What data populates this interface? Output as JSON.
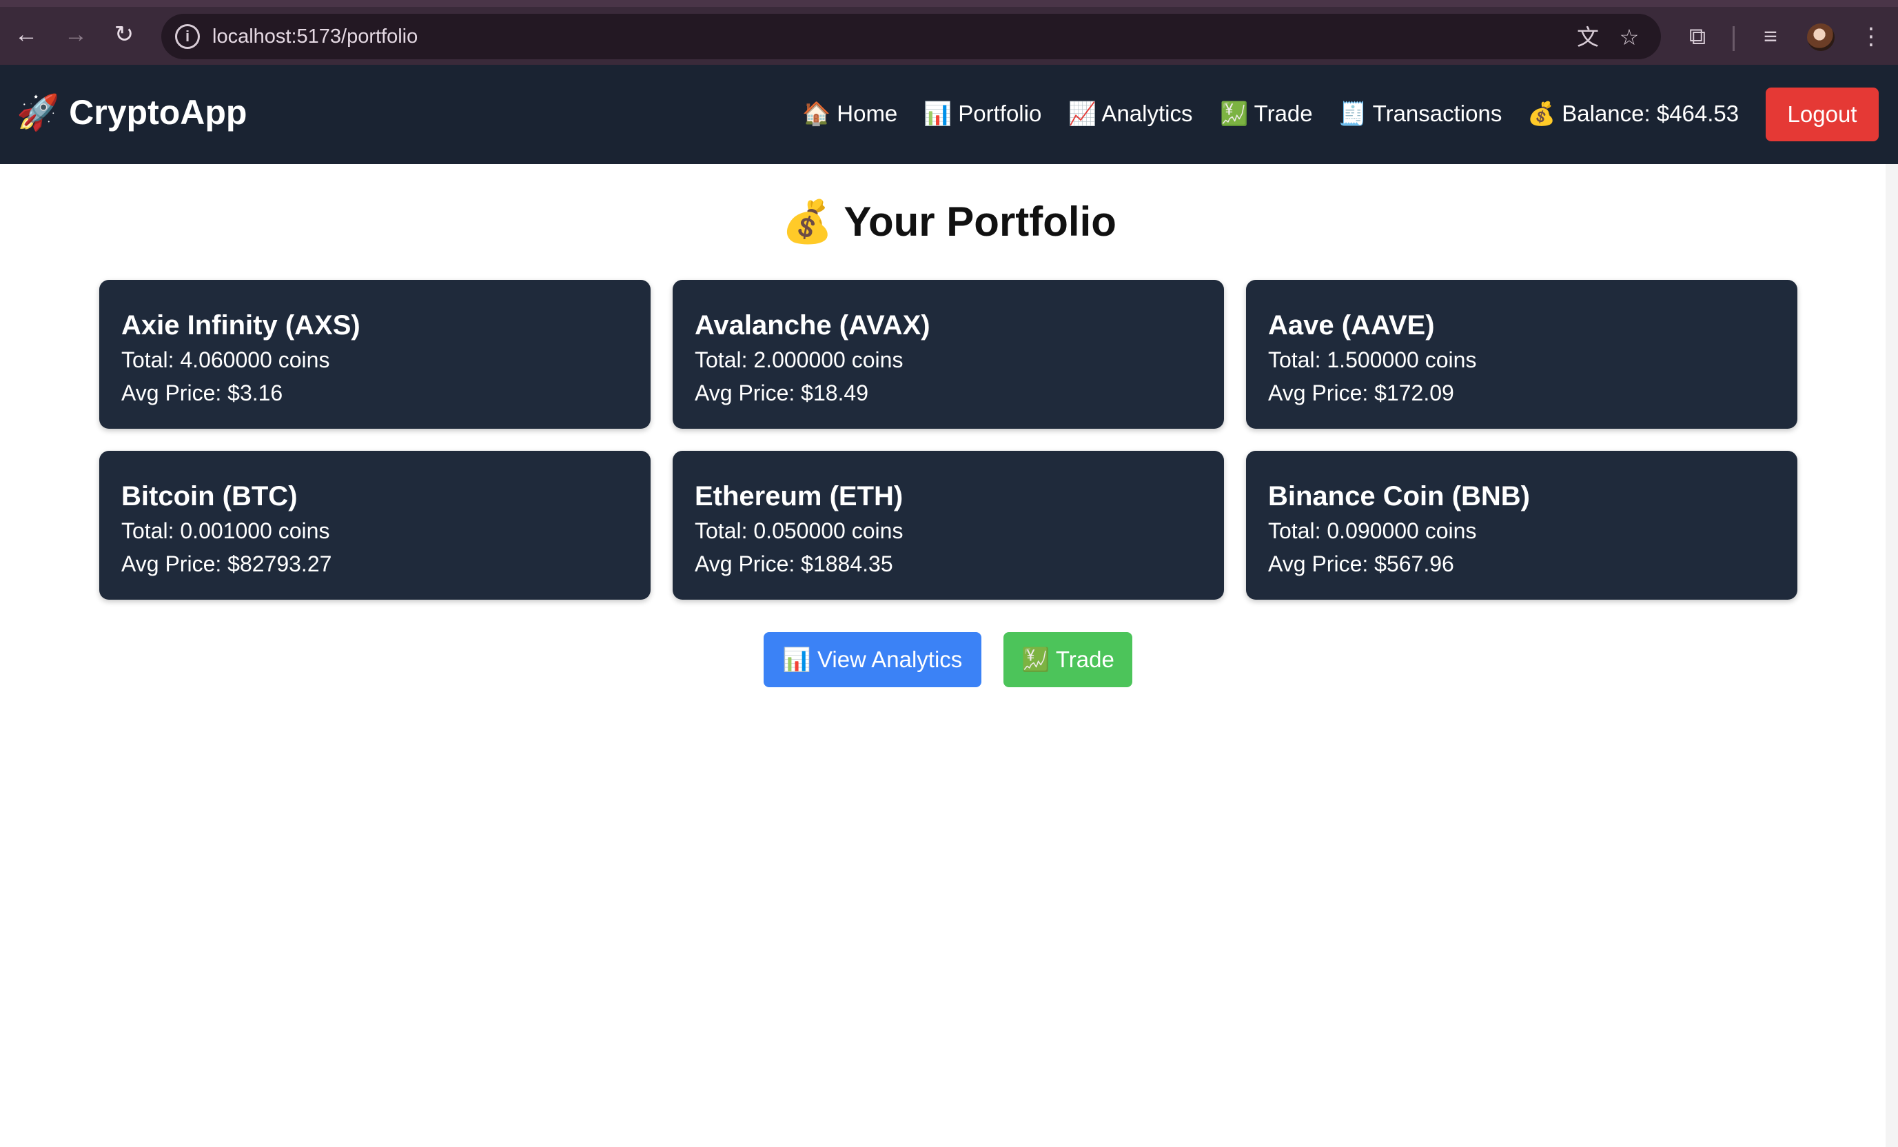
{
  "browser": {
    "url": "localhost:5173/portfolio",
    "icons": {
      "back": "←",
      "forward": "→",
      "reload": "↻",
      "info": "i",
      "translate": "文",
      "bookmark": "☆",
      "extensions": "⧉",
      "media": "≡",
      "menu": "⋮"
    }
  },
  "header": {
    "brand": "🚀 CryptoApp",
    "nav": {
      "home": "🏠 Home",
      "portfolio": "📊 Portfolio",
      "analytics": "📈 Analytics",
      "trade": "💹 Trade",
      "transactions": "🧾 Transactions",
      "balance": "💰 Balance: $464.53"
    },
    "logout_label": "Logout"
  },
  "main": {
    "title": "💰 Your Portfolio",
    "holdings": [
      {
        "name": "Axie Infinity (AXS)",
        "total": "Total: 4.060000 coins",
        "avg": "Avg Price: $3.16"
      },
      {
        "name": "Avalanche (AVAX)",
        "total": "Total: 2.000000 coins",
        "avg": "Avg Price: $18.49"
      },
      {
        "name": "Aave (AAVE)",
        "total": "Total: 1.500000 coins",
        "avg": "Avg Price: $172.09"
      },
      {
        "name": "Bitcoin (BTC)",
        "total": "Total: 0.001000 coins",
        "avg": "Avg Price: $82793.27"
      },
      {
        "name": "Ethereum (ETH)",
        "total": "Total: 0.050000 coins",
        "avg": "Avg Price: $1884.35"
      },
      {
        "name": "Binance Coin (BNB)",
        "total": "Total: 0.090000 coins",
        "avg": "Avg Price: $567.96"
      }
    ],
    "actions": {
      "view_analytics": "📊 View Analytics",
      "trade": "💹 Trade"
    }
  },
  "colors": {
    "header_bg": "#1a2332",
    "card_bg": "#1f2a3b",
    "logout": "#e53935",
    "analytics_button": "#3b82f6",
    "trade_button": "#4cc45a"
  }
}
